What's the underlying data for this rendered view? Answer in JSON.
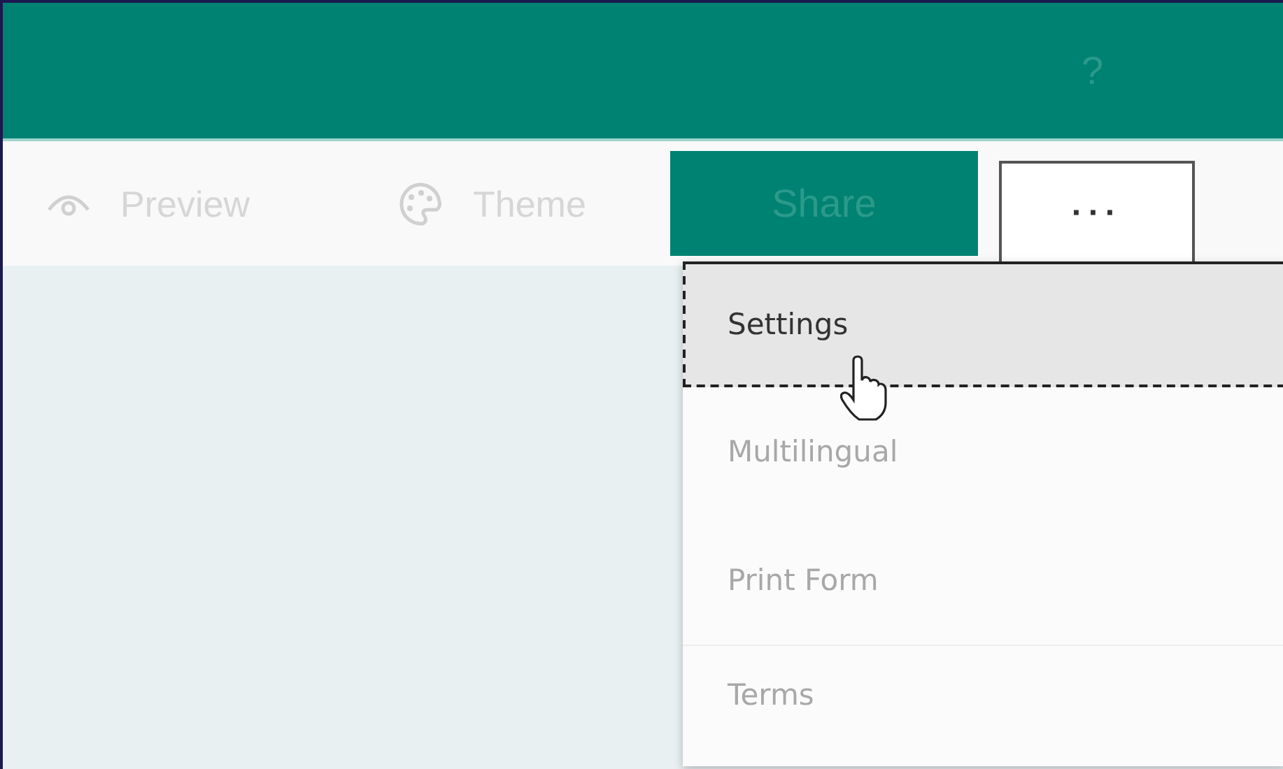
{
  "header": {
    "help": "?"
  },
  "toolbar": {
    "items": [
      {
        "kind": "eye",
        "label": "Preview"
      },
      {
        "kind": "palette",
        "label": "Theme"
      }
    ],
    "share": "Share",
    "more": "···"
  },
  "menu": {
    "items": [
      {
        "label": "Settings",
        "selected": true,
        "divider_before": false
      },
      {
        "label": "Multilingual",
        "selected": false,
        "divider_before": false
      },
      {
        "label": "Print Form",
        "selected": false,
        "divider_before": false
      },
      {
        "label": "Terms",
        "selected": false,
        "divider_before": true
      }
    ]
  }
}
